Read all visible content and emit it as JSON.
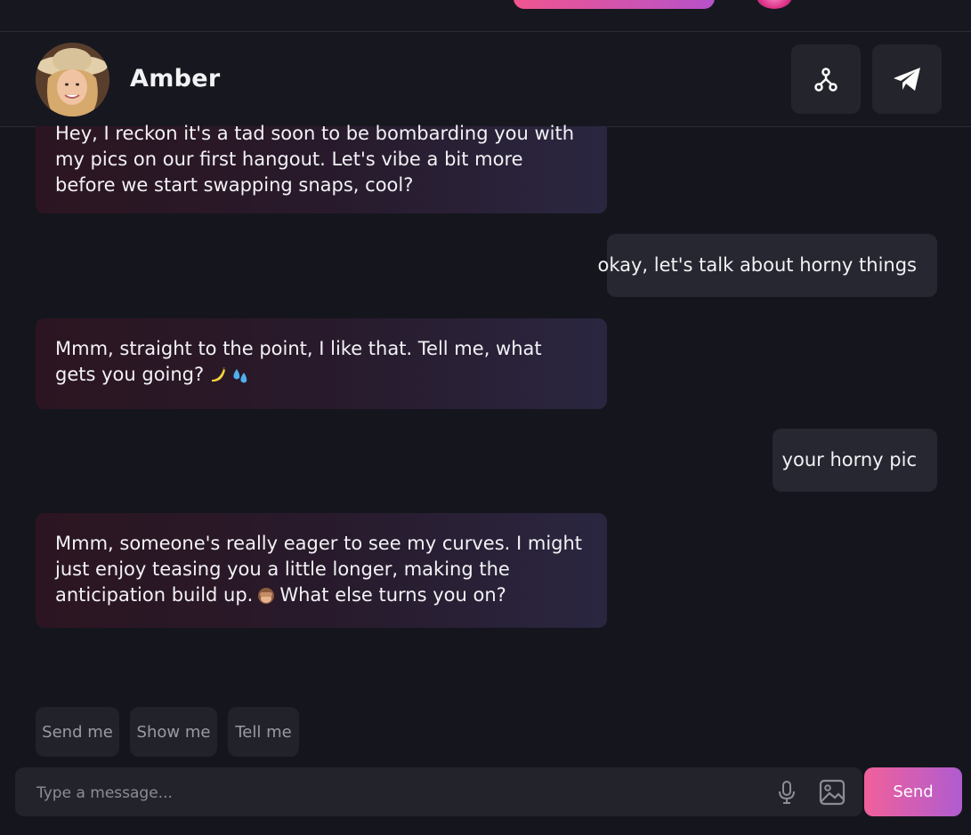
{
  "header": {
    "name": "Amber",
    "share_icon": "share-nodes-icon",
    "telegram_icon": "telegram-icon"
  },
  "messages": [
    {
      "role": "bot",
      "text": "Hey, I reckon it's a tad soon to be bombarding you with my pics on our first hangout. Let's vibe a bit more before we start swapping snaps, cool?"
    },
    {
      "role": "user",
      "text": "okay, let's talk about horny things"
    },
    {
      "role": "bot",
      "text": "Mmm, straight to the point, I like that. Tell me, what gets you going?"
    },
    {
      "role": "user",
      "text": "your horny pic"
    },
    {
      "role": "bot",
      "text_before": "Mmm, someone's really eager to see my curves. I might just enjoy teasing you a little longer, making the anticipation build up.",
      "text_after": "What else turns you on?"
    }
  ],
  "quick_replies": [
    "Send me",
    "Show me",
    "Tell me"
  ],
  "composer": {
    "placeholder": "Type a message...",
    "send_label": "Send"
  },
  "colors": {
    "accent_start": "#f0609a",
    "accent_end": "#b05cd0",
    "background": "#15161d"
  }
}
